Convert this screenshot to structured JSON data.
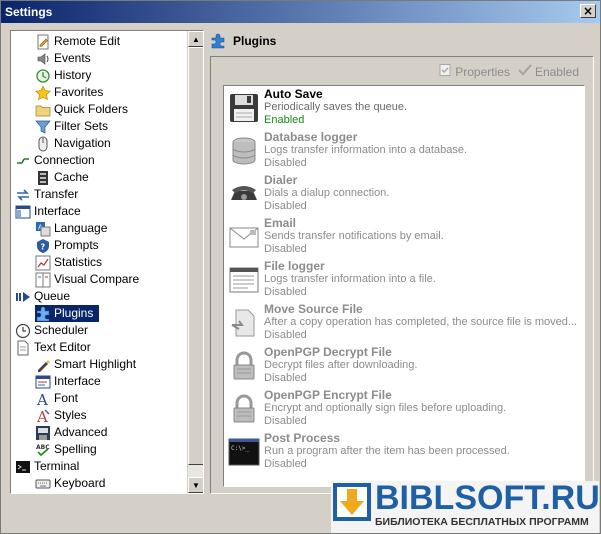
{
  "window": {
    "title": "Settings",
    "close_glyph": "×"
  },
  "tree": {
    "items": [
      {
        "label": "Remote Edit",
        "icon": "remote-edit-icon",
        "level": 1
      },
      {
        "label": "Events",
        "icon": "events-icon",
        "level": 1
      },
      {
        "label": "History",
        "icon": "history-icon",
        "level": 1
      },
      {
        "label": "Favorites",
        "icon": "favorites-icon",
        "level": 1
      },
      {
        "label": "Quick Folders",
        "icon": "quick-folders-icon",
        "level": 1
      },
      {
        "label": "Filter Sets",
        "icon": "filter-sets-icon",
        "level": 1
      },
      {
        "label": "Navigation",
        "icon": "navigation-icon",
        "level": 1
      },
      {
        "label": "Connection",
        "icon": "connection-icon",
        "level": 0
      },
      {
        "label": "Cache",
        "icon": "cache-icon",
        "level": 1
      },
      {
        "label": "Transfer",
        "icon": "transfer-icon",
        "level": 0
      },
      {
        "label": "Interface",
        "icon": "interface-icon",
        "level": 0
      },
      {
        "label": "Language",
        "icon": "language-icon",
        "level": 1
      },
      {
        "label": "Prompts",
        "icon": "prompts-icon",
        "level": 1
      },
      {
        "label": "Statistics",
        "icon": "statistics-icon",
        "level": 1
      },
      {
        "label": "Visual Compare",
        "icon": "visual-compare-icon",
        "level": 1
      },
      {
        "label": "Queue",
        "icon": "queue-icon",
        "level": 0
      },
      {
        "label": "Plugins",
        "icon": "plugins-icon",
        "level": 1,
        "selected": true
      },
      {
        "label": "Scheduler",
        "icon": "scheduler-icon",
        "level": 0
      },
      {
        "label": "Text Editor",
        "icon": "text-editor-icon",
        "level": 0
      },
      {
        "label": "Smart Highlight",
        "icon": "smart-highlight-icon",
        "level": 1
      },
      {
        "label": "Interface",
        "icon": "editor-interface-icon",
        "level": 1
      },
      {
        "label": "Font",
        "icon": "font-icon",
        "level": 1
      },
      {
        "label": "Styles",
        "icon": "styles-icon",
        "level": 1
      },
      {
        "label": "Advanced",
        "icon": "advanced-icon",
        "level": 1
      },
      {
        "label": "Spelling",
        "icon": "spelling-icon",
        "level": 1
      },
      {
        "label": "Terminal",
        "icon": "terminal-icon",
        "level": 0
      },
      {
        "label": "Keyboard",
        "icon": "keyboard-icon",
        "level": 1
      }
    ]
  },
  "panel": {
    "title": "Plugins",
    "toolbar": {
      "properties_label": "Properties",
      "enabled_label": "Enabled"
    },
    "plugins": [
      {
        "name": "Auto Save",
        "description": "Periodically saves the queue.",
        "status": "Enabled",
        "icon": "floppy-disk-icon",
        "active": true
      },
      {
        "name": "Database logger",
        "description": "Logs transfer information into a database.",
        "status": "Disabled",
        "icon": "database-icon"
      },
      {
        "name": "Dialer",
        "description": "Dials a dialup connection.",
        "status": "Disabled",
        "icon": "telephone-icon"
      },
      {
        "name": "Email",
        "description": "Sends transfer notifications by email.",
        "status": "Disabled",
        "icon": "envelope-icon"
      },
      {
        "name": "File logger",
        "description": "Logs transfer information into a file.",
        "status": "Disabled",
        "icon": "log-file-icon"
      },
      {
        "name": "Move Source File",
        "description": "After a copy operation has completed, the source file is moved...",
        "status": "Disabled",
        "icon": "move-file-icon"
      },
      {
        "name": "OpenPGP Decrypt File",
        "description": "Decrypt files after downloading.",
        "status": "Disabled",
        "icon": "padlock-icon"
      },
      {
        "name": "OpenPGP Encrypt File",
        "description": "Encrypt and optionally sign files before uploading.",
        "status": "Disabled",
        "icon": "padlock-icon"
      },
      {
        "name": "Post Process",
        "description": "Run a program after the item has been processed.",
        "status": "Disabled",
        "icon": "command-prompt-icon"
      }
    ]
  },
  "watermark": {
    "title": "BIBLSOFT.RU",
    "subtitle": "БИБЛИОТЕКА БЕСПЛАТНЫХ ПРОГРАММ"
  },
  "colors": {
    "selection": "#0a246a",
    "enabled_status": "#1a8a1a",
    "disabled_text": "#8c8c8c",
    "window_bg": "#d4d0c8",
    "watermark_blue": "#1f5fa6"
  }
}
